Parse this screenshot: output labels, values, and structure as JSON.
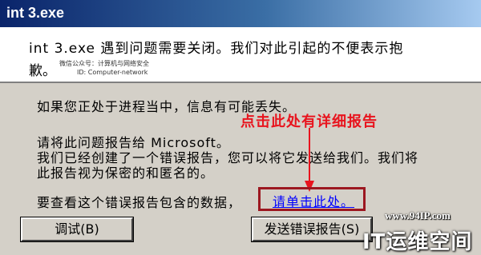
{
  "window": {
    "title": "int 3.exe"
  },
  "header": {
    "line1": "int 3.exe 遇到问题需要关闭。我们对此引起的不便表示抱",
    "line2": "歉。",
    "watermark1": "微信公众号：计算机与网络安全",
    "watermark2": "ID: Computer-network"
  },
  "body": {
    "progress_note": "如果您正处于进程当中，信息有可能丢失。",
    "report_line1": "请将此问题报告给 Microsoft。",
    "report_line2": "我们已经创建了一个错误报告，您可以将它发送给我们。我们将",
    "report_line3": "此报告视为保密的和匿名的。",
    "data_prompt": "要查看这个错误报告包含的数据，",
    "details_link": "请单击此处。"
  },
  "annotation": {
    "text": "点击此处有详细报告",
    "color": "#e8141e"
  },
  "buttons": {
    "debug": "调试(B)",
    "send": "发送错误报告(S)"
  },
  "overlay": {
    "site_url": "www.94IP.com",
    "site_name": "IT运维空间"
  }
}
